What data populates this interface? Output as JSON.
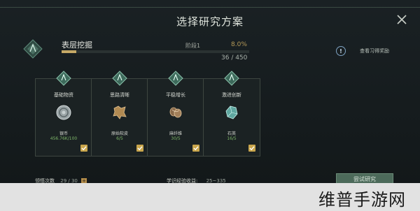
{
  "title": "选择研究方案",
  "research": {
    "name": "表层挖掘",
    "stage": "阶段1",
    "percent": "8.0%",
    "progress_fraction": 0.08,
    "count": "36 / 450"
  },
  "info": {
    "text": "查看习得奖励"
  },
  "cards": [
    {
      "label": "基础物资",
      "item": "银币",
      "qty": "456.76K/100",
      "icon": "silver-coin-icon"
    },
    {
      "label": "思路清晰",
      "item": "原始软皮",
      "qty": "6/5",
      "icon": "leather-icon"
    },
    {
      "label": "平稳增长",
      "item": "麻纤维",
      "qty": "30/5",
      "icon": "fiber-icon"
    },
    {
      "label": "激进创新",
      "item": "石英",
      "qty": "16/5",
      "icon": "quartz-icon"
    }
  ],
  "bottom": {
    "inspiration_label": "领悟次数",
    "inspiration_value": "29 / 30",
    "exp_label": "学识经验收益:",
    "exp_value": "25~335"
  },
  "try_button": "尝试研究",
  "watermark": "维普手游网",
  "colors": {
    "accent_gold": "#c5a866",
    "bar_bg": "#2a3232",
    "check_gold": "#c9a64c",
    "qty_green": "#7fb86a"
  }
}
